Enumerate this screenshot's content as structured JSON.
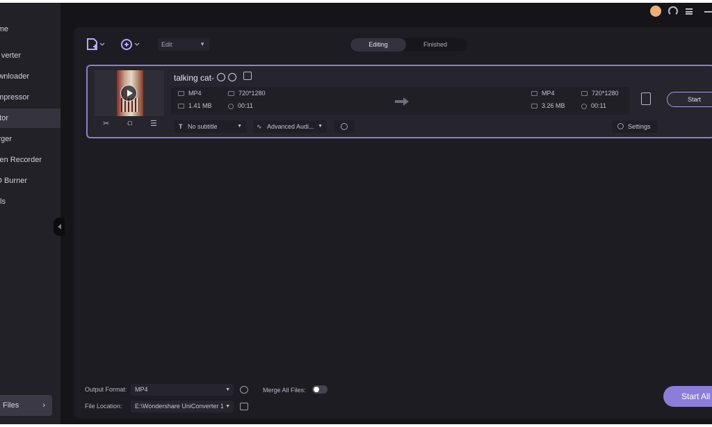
{
  "topbar": {
    "avatar_color": "#e8b07a"
  },
  "sidebar": {
    "items": [
      {
        "label": "me"
      },
      {
        "label": "verter"
      },
      {
        "label": "wnloader"
      },
      {
        "label": "mpressor"
      },
      {
        "label": "tor"
      },
      {
        "label": "rger"
      },
      {
        "label": "een Recorder"
      },
      {
        "label": "D Burner"
      },
      {
        "label": "ls"
      }
    ],
    "active_index": 4,
    "my_files_label": "Files",
    "my_files_chevron": "›"
  },
  "toolbar": {
    "edit_select_value": "Edit",
    "tabs": [
      {
        "label": "Editing"
      },
      {
        "label": "Finished"
      }
    ],
    "active_tab": "Editing"
  },
  "file": {
    "name": "talking cat-",
    "source": {
      "format": "MP4",
      "resolution": "720*1280",
      "size": "1.41 MB",
      "duration": "00:11"
    },
    "output": {
      "format": "MP4",
      "resolution": "720*1280",
      "size": "3.26 MB",
      "duration": "00:11"
    },
    "subtitle": "No subtitle",
    "audio": "Advanced Audi...",
    "settings_label": "Settings",
    "start_label": "Start"
  },
  "bottom": {
    "output_format_label": "Output Format:",
    "output_format_value": "MP4",
    "merge_label": "Merge All Files:",
    "file_location_label": "File Location:",
    "file_location_value": "E:\\Wondershare UniConverter 1",
    "start_all_label": "Start All"
  },
  "colors": {
    "accent": "#8c7ed8",
    "card_border": "#8d7fd6",
    "panel_bg": "#1d1c23"
  }
}
